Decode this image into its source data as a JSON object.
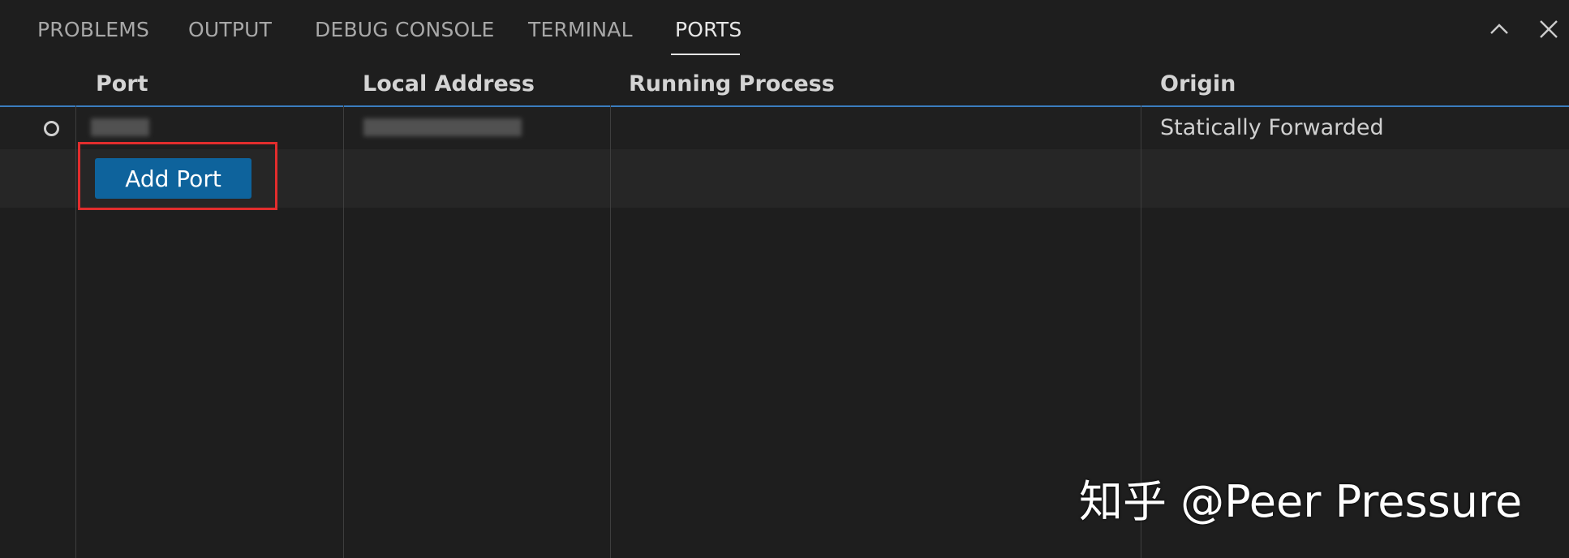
{
  "panel": {
    "tabs": [
      {
        "label": "PROBLEMS",
        "active": false
      },
      {
        "label": "OUTPUT",
        "active": false
      },
      {
        "label": "DEBUG CONSOLE",
        "active": false
      },
      {
        "label": "TERMINAL",
        "active": false
      },
      {
        "label": "PORTS",
        "active": true
      }
    ],
    "actions": {
      "maximize_icon": "chevron-up-icon",
      "close_icon": "close-icon"
    }
  },
  "ports_table": {
    "columns": [
      "Port",
      "Local Address",
      "Running Process",
      "Origin"
    ],
    "rows": [
      {
        "status_icon": "circle-outline-icon",
        "port": "",
        "local_address": "",
        "running_process": "",
        "origin": "Statically Forwarded",
        "redacted": true
      }
    ],
    "add_port_label": "Add Port"
  },
  "watermark": {
    "text": "知乎 @Peer Pressure"
  },
  "colors": {
    "background": "#1e1e1e",
    "accent_line": "#3b7dbf",
    "button": "#0e639c",
    "highlight_box": "#e22d2d"
  }
}
